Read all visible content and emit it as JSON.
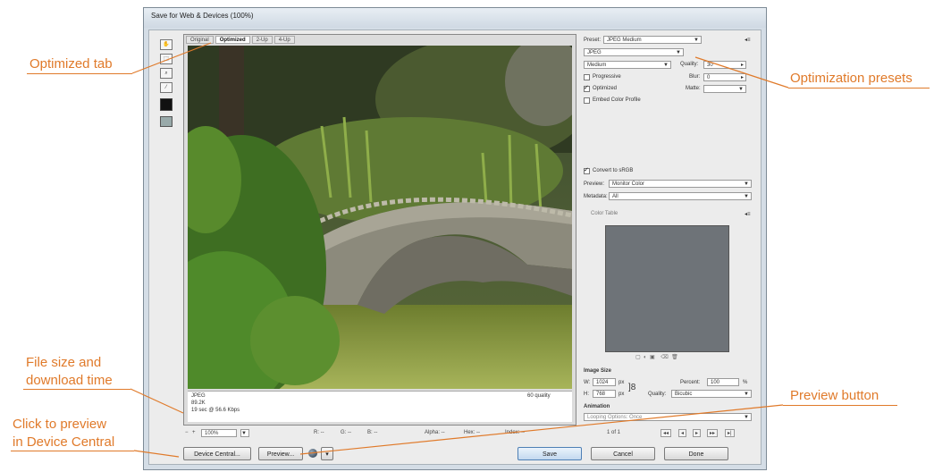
{
  "window": {
    "title": "Save for Web & Devices (100%)"
  },
  "tabs": [
    "Original",
    "Optimized",
    "2-Up",
    "4-Up"
  ],
  "infobar": {
    "format": "JPEG",
    "size": "89.2K",
    "download": "19 sec @ 56.6 Kbps",
    "quality": "60 quality"
  },
  "settings": {
    "preset_label": "Preset:",
    "preset_value": "JPEG Medium",
    "format_value": "JPEG",
    "compression_value": "Medium",
    "quality_label": "Quality:",
    "quality_value": "30",
    "progressive_label": "Progressive",
    "blur_label": "Blur:",
    "blur_value": "0",
    "optimized_label": "Optimized",
    "matte_label": "Matte:",
    "embed_label": "Embed Color Profile",
    "convert_label": "Convert to sRGB",
    "preview_label": "Preview:",
    "preview_value": "Monitor Color",
    "metadata_label": "Metadata:",
    "metadata_value": "All",
    "color_table_label": "Color Table",
    "image_size_label": "Image Size",
    "w_label": "W:",
    "w_value": "1024",
    "h_label": "H:",
    "h_value": "768",
    "px": "px",
    "percent_label": "Percent:",
    "percent_value": "100",
    "percent_sign": "%",
    "quality2_label": "Quality:",
    "quality2_value": "Bicubic",
    "animation_label": "Animation",
    "looping_value": "Looping Options: Once",
    "frame_counter": "1 of 1"
  },
  "zoom": {
    "value": "100%"
  },
  "readouts": {
    "r": "R: --",
    "g": "G: --",
    "b": "B: --",
    "alpha": "Alpha: --",
    "hex": "Hex: --",
    "index": "Index: --"
  },
  "buttons": {
    "device_central": "Device Central...",
    "preview": "Preview...",
    "save": "Save",
    "cancel": "Cancel",
    "done": "Done"
  },
  "annotations": {
    "optimized_tab": "Optimized tab",
    "optimization_presets": "Optimization presets",
    "file_size_1": "File size and",
    "file_size_2": "download time",
    "preview_button": "Preview button",
    "click_preview_1": "Click to preview",
    "click_preview_2": "in Device Central"
  },
  "colors": {
    "annotation": "#e07a2a",
    "color_table": "#6e7378"
  }
}
